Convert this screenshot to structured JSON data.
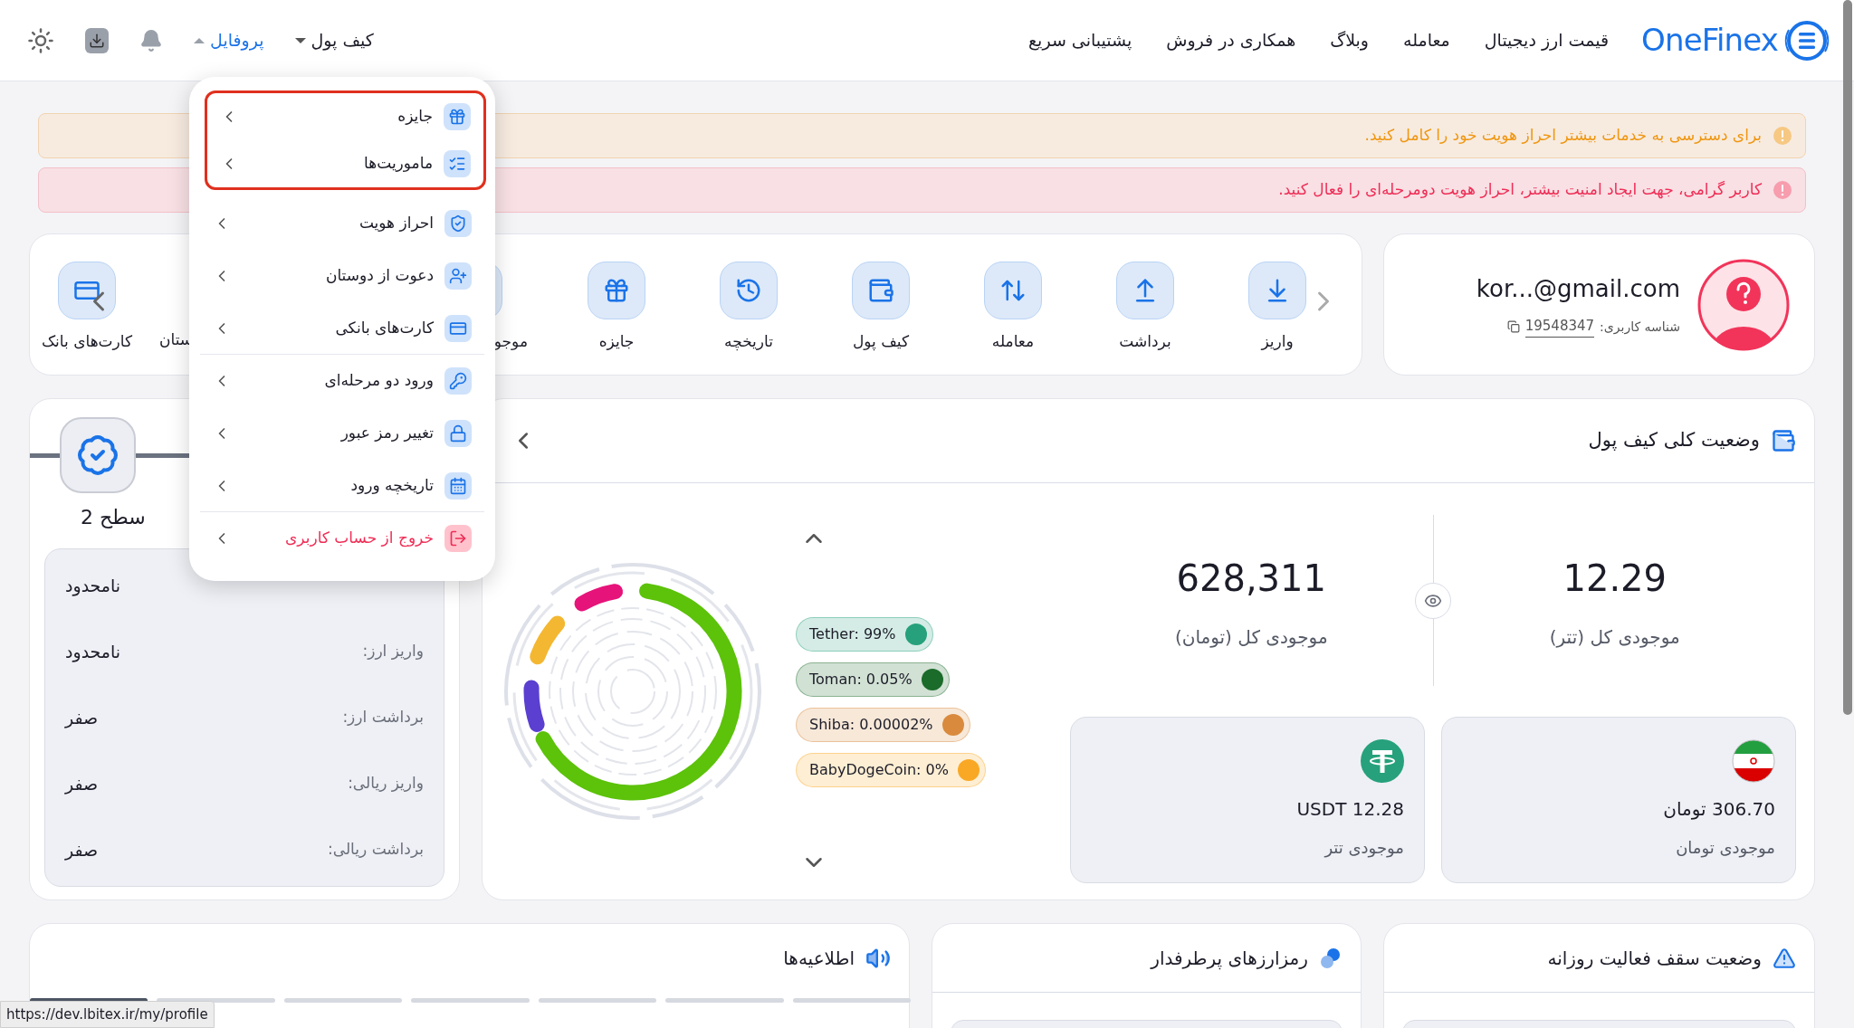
{
  "header": {
    "brand": "OneFinex",
    "nav": [
      {
        "label": "قیمت ارز دیجیتال"
      },
      {
        "label": "معامله"
      },
      {
        "label": "وبلاگ"
      },
      {
        "label": "همکاری در فروش"
      },
      {
        "label": "پشتیبانی سریع"
      }
    ],
    "menus": [
      {
        "label": "کیف پول",
        "selected": false
      },
      {
        "label": "پروفایل",
        "selected": true
      }
    ]
  },
  "profile_menu": [
    {
      "label": "جایزه",
      "kind": "normal",
      "highlighted": true,
      "separator_after": false
    },
    {
      "label": "ماموریت‌ها",
      "kind": "normal",
      "highlighted": true,
      "separator_after": false
    },
    {
      "label": "احراز هویت",
      "kind": "normal",
      "highlighted": false,
      "separator_after": false
    },
    {
      "label": "دعوت از دوستان",
      "kind": "normal",
      "highlighted": false,
      "separator_after": false
    },
    {
      "label": "کارت‌های بانکی",
      "kind": "normal",
      "highlighted": false,
      "separator_after": true
    },
    {
      "label": "ورود دو مرحله‌ای",
      "kind": "normal",
      "highlighted": false,
      "separator_after": false
    },
    {
      "label": "تغییر رمز عبور",
      "kind": "normal",
      "highlighted": false,
      "separator_after": false
    },
    {
      "label": "تاریخچه ورود",
      "kind": "normal",
      "highlighted": false,
      "separator_after": true
    },
    {
      "label": "خروج از حساب کاربری",
      "kind": "danger",
      "highlighted": false,
      "separator_after": false
    }
  ],
  "alerts": [
    {
      "kind": "warning",
      "text": "برای دسترسی به خدمات بیشتر احراز هویت خود را کامل کنید."
    },
    {
      "kind": "danger",
      "text": "کاربر گرامی، جهت ایجاد امنیت بیشتر، احراز هویت دومرحله‌ای را فعال کنید."
    }
  ],
  "user": {
    "email": "kor...@gmail.com",
    "id_label": "شناسه کاربری:",
    "id": "19548347"
  },
  "quick_actions": [
    {
      "label": "واریز",
      "kind": "full"
    },
    {
      "label": "برداشت",
      "kind": "full"
    },
    {
      "label": "معامله",
      "kind": "full"
    },
    {
      "label": "کیف پول",
      "kind": "full"
    },
    {
      "label": "تاریخچه",
      "kind": "full"
    },
    {
      "label": "جایزه",
      "kind": "full"
    },
    {
      "label": "موجو",
      "kind": "cut"
    },
    {
      "label": "ستان",
      "kind": "label_only"
    },
    {
      "label": "کارت‌های بانک",
      "kind": "full"
    }
  ],
  "level": {
    "label": "سطح 2"
  },
  "limits": [
    {
      "value": "نامحدود"
    },
    {
      "label": "واریز ارز:",
      "value": "نامحدود"
    },
    {
      "label": "برداشت ارز:",
      "value": "صفر"
    },
    {
      "label": "واریز ریالی:",
      "value": "صفر"
    },
    {
      "label": "برداشت ریالی:",
      "value": "صفر"
    }
  ],
  "wallet": {
    "title": "وضعیت کلی کیف پول",
    "legend": [
      {
        "label": "Tether: 99%",
        "color": "#26a17b"
      },
      {
        "label": "Toman: 0.05%",
        "color": "#1b6b2a"
      },
      {
        "label": "Shiba: 0.00002%",
        "color": "#d98a3d"
      },
      {
        "label": "BabyDogeCoin: 0%",
        "color": "#f9a825"
      }
    ],
    "totals": [
      {
        "value": "12.29",
        "label": "موجودی کل (تتر)"
      },
      {
        "value": "628,311",
        "label": "موجودی کل (تومان)"
      }
    ],
    "balances": [
      {
        "kind": "toman",
        "amount": "306.70 تومان",
        "label": "موجودی تومان"
      },
      {
        "kind": "usdt",
        "amount": "USDT 12.28",
        "label": "موجودی تتر"
      }
    ]
  },
  "bottom_cards": [
    {
      "kind": "limits",
      "title": "وضعیت سقف فعالیت روزانه"
    },
    {
      "kind": "popular",
      "title": "رمزارزهای پرطرفدار"
    },
    {
      "kind": "news",
      "title": "اطلاعیه‌ها"
    }
  ],
  "status_url": "https://dev.lbitex.ir/my/profile"
}
